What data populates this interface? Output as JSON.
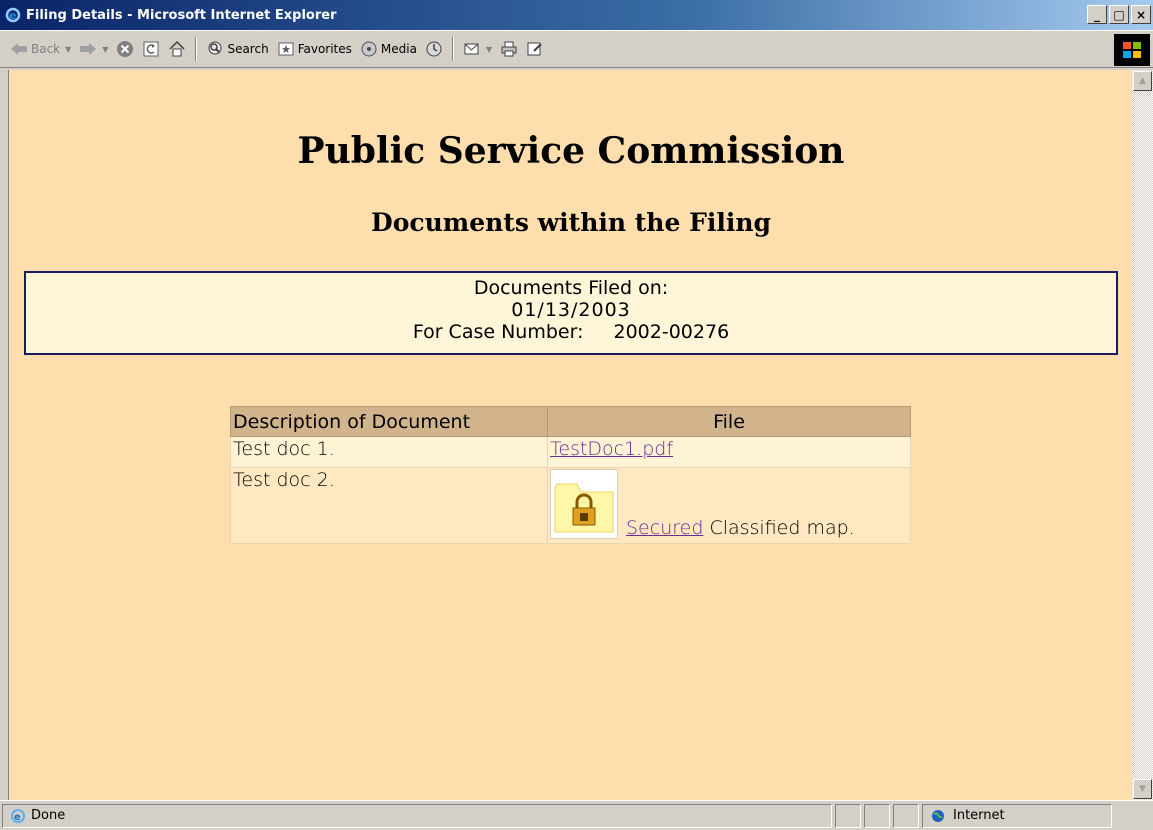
{
  "window": {
    "title": "Filing Details - Microsoft Internet Explorer",
    "controls": {
      "minimize": "_",
      "maximize": "□",
      "close": "×"
    }
  },
  "toolbar": {
    "back_label": "Back",
    "search_label": "Search",
    "favorites_label": "Favorites",
    "media_label": "Media"
  },
  "page": {
    "heading": "Public Service Commission",
    "subheading": "Documents within the Filing",
    "filed_on_label": "Documents Filed on:",
    "filed_on_date": "01/13/2003",
    "case_label": "For Case Number:",
    "case_number": "2002-00276"
  },
  "documents": {
    "headers": [
      "Description of Document",
      "File"
    ],
    "rows": [
      {
        "description": "Test doc 1.",
        "file_link": "TestDoc1.pdf"
      },
      {
        "description": "Test doc 2.",
        "secured_link": "Secured",
        "note": "Classified map."
      }
    ]
  },
  "status": {
    "text": "Done",
    "zone": "Internet"
  },
  "colors": {
    "page_background": "#ffdead",
    "infobox_background": "#fff5d8",
    "table_header": "#d2b48c",
    "link": "#6b2c91",
    "titlebar_start": "#0a246a"
  }
}
